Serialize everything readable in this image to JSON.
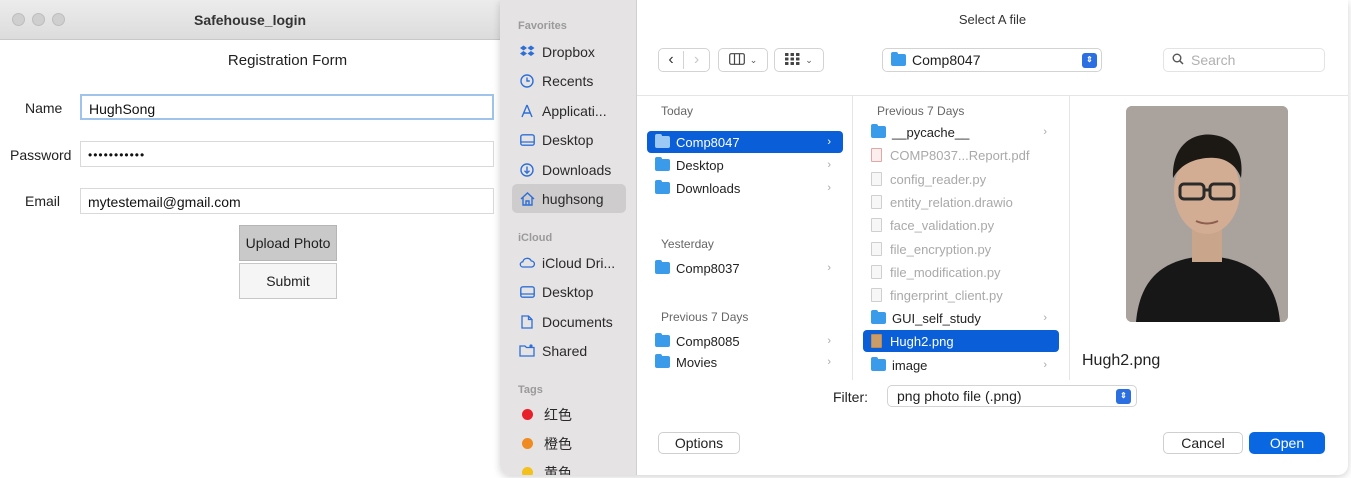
{
  "left_window": {
    "title": "Safehouse_login",
    "form_title": "Registration Form",
    "fields": {
      "name_label": "Name",
      "name_value": "HughSong",
      "password_label": "Password",
      "password_value": "•••••••••••",
      "email_label": "Email",
      "email_value": "mytestemail@gmail.com"
    },
    "upload_label": "Upload Photo",
    "submit_label": "Submit"
  },
  "dialog": {
    "title": "Select A file",
    "sidebar": {
      "favorites_header": "Favorites",
      "favorites": [
        {
          "label": "Dropbox",
          "icon": "dropbox-icon"
        },
        {
          "label": "Recents",
          "icon": "clock-icon"
        },
        {
          "label": "Applicati...",
          "icon": "applications-icon"
        },
        {
          "label": "Desktop",
          "icon": "desktop-icon"
        },
        {
          "label": "Downloads",
          "icon": "downloads-icon"
        },
        {
          "label": "hughsong",
          "icon": "home-icon"
        }
      ],
      "icloud_header": "iCloud",
      "icloud": [
        {
          "label": "iCloud Dri...",
          "icon": "cloud-icon"
        },
        {
          "label": "Desktop",
          "icon": "desktop-icon"
        },
        {
          "label": "Documents",
          "icon": "document-icon"
        },
        {
          "label": "Shared",
          "icon": "shared-folder-icon"
        }
      ],
      "tags_header": "Tags",
      "tags": [
        {
          "label": "红色",
          "color": "#e8202a"
        },
        {
          "label": "橙色",
          "color": "#f08a22"
        },
        {
          "label": "黄色",
          "color": "#f3c01c"
        }
      ]
    },
    "toolbar": {
      "back_icon": "‹",
      "forward_icon": "›",
      "view_columns_icon": "columns-icon",
      "view_grid_icon": "grid-icon",
      "current_folder": "Comp8047",
      "search_placeholder": "Search"
    },
    "column1": {
      "today_header": "Today",
      "today": [
        "Comp8047",
        "Desktop",
        "Downloads"
      ],
      "yesterday_header": "Yesterday",
      "yesterday": [
        "Comp8037"
      ],
      "prev_header": "Previous 7 Days",
      "prev": [
        "Comp8085",
        "Movies"
      ]
    },
    "column2": {
      "header": "Previous 7 Days",
      "items": [
        {
          "name": "__pycache__",
          "kind": "folder",
          "enabled": true
        },
        {
          "name": "COMP8037...Report.pdf",
          "kind": "pdf",
          "enabled": false
        },
        {
          "name": "config_reader.py",
          "kind": "file",
          "enabled": false
        },
        {
          "name": "entity_relation.drawio",
          "kind": "file",
          "enabled": false
        },
        {
          "name": "face_validation.py",
          "kind": "file",
          "enabled": false
        },
        {
          "name": "file_encryption.py",
          "kind": "file",
          "enabled": false
        },
        {
          "name": "file_modification.py",
          "kind": "file",
          "enabled": false
        },
        {
          "name": "fingerprint_client.py",
          "kind": "file",
          "enabled": false
        },
        {
          "name": "GUI_self_study",
          "kind": "folder",
          "enabled": true
        },
        {
          "name": "Hugh2.png",
          "kind": "image",
          "enabled": true
        },
        {
          "name": "image",
          "kind": "folder",
          "enabled": true
        }
      ]
    },
    "preview": {
      "filename": "Hugh2.png"
    },
    "filter": {
      "label": "Filter:",
      "value": "png photo file (.png)"
    },
    "buttons": {
      "options": "Options",
      "cancel": "Cancel",
      "open": "Open"
    }
  }
}
